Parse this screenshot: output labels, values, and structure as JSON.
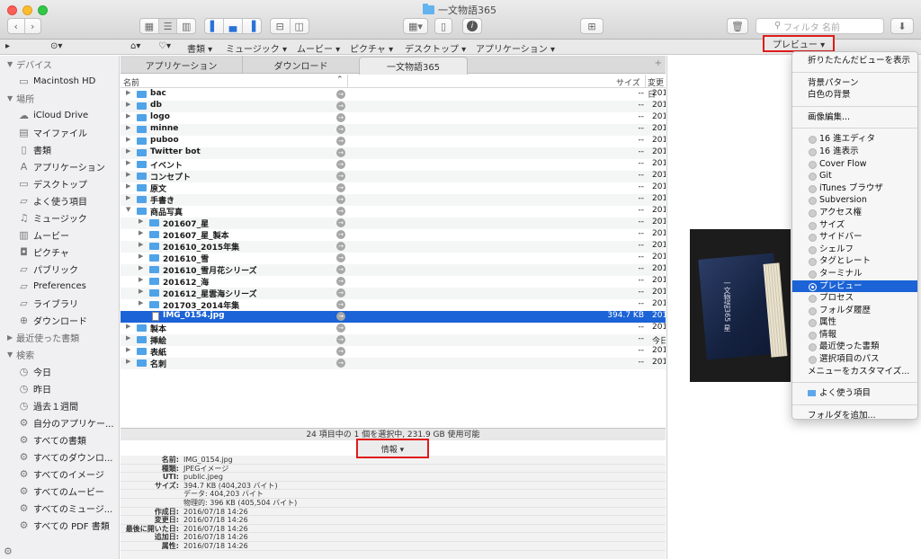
{
  "window": {
    "title": "一文物語365"
  },
  "toolbar": {
    "search_placeholder": "フィルタ 名前"
  },
  "favorites_bar": {
    "items": [
      "書類",
      "ミュージック",
      "ムービー",
      "ピクチャ",
      "デスクトップ",
      "アプリケーション"
    ],
    "preview_button": "プレビュー ▾"
  },
  "sidebar": {
    "devices_header": "デバイス",
    "devices": [
      "Macintosh HD"
    ],
    "places_header": "場所",
    "places": [
      "iCloud Drive",
      "マイファイル",
      "書類",
      "アプリケーション",
      "デスクトップ",
      "よく使う項目",
      "ミュージック",
      "ムービー",
      "ピクチャ",
      "パブリック",
      "Preferences",
      "ライブラリ",
      "ダウンロード"
    ],
    "recent_header": "最近使った書類",
    "search_header": "検索",
    "searches": [
      "今日",
      "昨日",
      "過去１週間",
      "自分のアプリケー...",
      "すべての書類",
      "すべてのダウンロ...",
      "すべてのイメージ",
      "すべてのムービー",
      "すべてのミュージ...",
      "すべての PDF 書類"
    ]
  },
  "tabs": [
    "アプリケーション",
    "ダウンロード",
    "一文物語365"
  ],
  "columns": {
    "name": "名前",
    "size": "サイズ",
    "modified": "変更日"
  },
  "rows": [
    {
      "name": "bac",
      "size": "--",
      "date": "201",
      "level": 0,
      "kind": "folder"
    },
    {
      "name": "db",
      "size": "--",
      "date": "201",
      "level": 0,
      "kind": "folder"
    },
    {
      "name": "logo",
      "size": "--",
      "date": "201",
      "level": 0,
      "kind": "folder"
    },
    {
      "name": "minne",
      "size": "--",
      "date": "201",
      "level": 0,
      "kind": "folder"
    },
    {
      "name": "puboo",
      "size": "--",
      "date": "201",
      "level": 0,
      "kind": "folder"
    },
    {
      "name": "Twitter bot",
      "size": "--",
      "date": "201",
      "level": 0,
      "kind": "folder"
    },
    {
      "name": "イベント",
      "size": "--",
      "date": "201",
      "level": 0,
      "kind": "folder"
    },
    {
      "name": "コンセプト",
      "size": "--",
      "date": "201",
      "level": 0,
      "kind": "folder"
    },
    {
      "name": "原文",
      "size": "--",
      "date": "201",
      "level": 0,
      "kind": "folder"
    },
    {
      "name": "手書き",
      "size": "--",
      "date": "201",
      "level": 0,
      "kind": "folder"
    },
    {
      "name": "商品写真",
      "size": "--",
      "date": "201",
      "level": 0,
      "kind": "folder",
      "open": true
    },
    {
      "name": "201607_星",
      "size": "--",
      "date": "201",
      "level": 1,
      "kind": "folder"
    },
    {
      "name": "201607_星_製本",
      "size": "--",
      "date": "201",
      "level": 1,
      "kind": "folder"
    },
    {
      "name": "201610_2015年集",
      "size": "--",
      "date": "201",
      "level": 1,
      "kind": "folder"
    },
    {
      "name": "201610_雪",
      "size": "--",
      "date": "201",
      "level": 1,
      "kind": "folder"
    },
    {
      "name": "201610_雪月花シリーズ",
      "size": "--",
      "date": "201",
      "level": 1,
      "kind": "folder"
    },
    {
      "name": "201612_海",
      "size": "--",
      "date": "201",
      "level": 1,
      "kind": "folder"
    },
    {
      "name": "201612_星雲海シリーズ",
      "size": "--",
      "date": "201",
      "level": 1,
      "kind": "folder"
    },
    {
      "name": "201703_2014年集",
      "size": "--",
      "date": "201",
      "level": 1,
      "kind": "folder"
    },
    {
      "name": "IMG_0154.jpg",
      "size": "394.7 KB",
      "date": "201",
      "level": 1,
      "kind": "file",
      "selected": true
    },
    {
      "name": "製本",
      "size": "--",
      "date": "201",
      "level": 0,
      "kind": "folder"
    },
    {
      "name": "挿絵",
      "size": "--",
      "date": "今日",
      "level": 0,
      "kind": "folder"
    },
    {
      "name": "表紙",
      "size": "--",
      "date": "201",
      "level": 0,
      "kind": "folder"
    },
    {
      "name": "名刺",
      "size": "--",
      "date": "201",
      "level": 0,
      "kind": "folder"
    }
  ],
  "status_text": "24 項目中の 1 個を選択中, 231.9 GB 使用可能",
  "info_button": "情報 ▾",
  "info": [
    {
      "k": "名前:",
      "v": "IMG_0154.jpg"
    },
    {
      "k": "種類:",
      "v": "JPEGイメージ"
    },
    {
      "k": "UTI:",
      "v": "public.jpeg"
    },
    {
      "k": "サイズ:",
      "v": "394.7 KB (404,203 バイト)"
    },
    {
      "k": "",
      "v": "データ: 404,203 バイト"
    },
    {
      "k": "",
      "v": "物理的: 396 KB (405,504 バイト)"
    },
    {
      "k": "作成日:",
      "v": "2016/07/18 14:26"
    },
    {
      "k": "変更日:",
      "v": "2016/07/18 14:26"
    },
    {
      "k": "最後に開いた日:",
      "v": "2016/07/18 14:26"
    },
    {
      "k": "追加日:",
      "v": "2016/07/18 14:26"
    },
    {
      "k": "属性:",
      "v": "2016/07/18 14:26"
    }
  ],
  "menu": {
    "group1": [
      "折りたたんだビューを表示"
    ],
    "group2": [
      "背景パターン",
      "白色の背景"
    ],
    "group3": [
      "画像編集..."
    ],
    "radios": [
      "16 進エディタ",
      "16 進表示",
      "Cover Flow",
      "Git",
      "iTunes ブラウザ",
      "Subversion",
      "アクセス権",
      "サイズ",
      "サイドバー",
      "シェルフ",
      "タグとレート",
      "ターミナル",
      "プレビュー",
      "プロセス",
      "フォルダ履歴",
      "属性",
      "情報",
      "最近使った書類",
      "選択項目のパス"
    ],
    "selected_radio": "プレビュー",
    "customize": "メニューをカスタマイズ...",
    "favorites": "よく使う項目",
    "add_folder": "フォルダを追加..."
  },
  "preview": {
    "book_title": "一文物語365 星"
  }
}
